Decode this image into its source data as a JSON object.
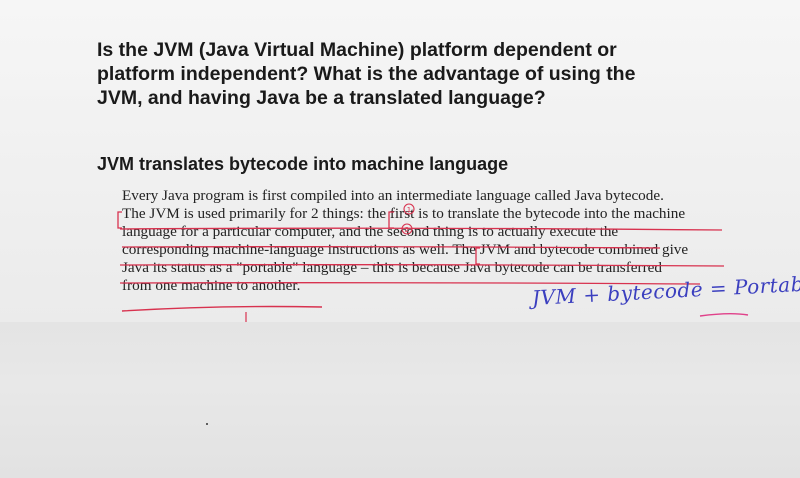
{
  "question": {
    "text": "Is the JVM (Java Virtual Machine) platform dependent or\nplatform independent? What is the advantage of using the\nJVM, and having Java be a translated language?"
  },
  "answer": {
    "heading": "JVM translates bytecode into machine language",
    "lines": [
      "Every Java program is first compiled into an intermediate language called Java bytecode.",
      "The JVM is used primarily for 2 things: the first is to translate the bytecode into the machine",
      "language for a particular computer, and the second thing is to actually execute the",
      "corresponding machine-language instructions as well. The JVM and bytecode combined give",
      "Java its status as a \"portable\" language – this is because Java bytecode can be transferred",
      "from one machine to another."
    ]
  },
  "annotations": {
    "handwritten_note": "JVM + bytecode = Portable",
    "marker_numbers": [
      "1",
      "2"
    ],
    "ink_colors": {
      "red": "#d8324f",
      "blue": "#3b3fbf",
      "pink": "#e0418a"
    }
  }
}
